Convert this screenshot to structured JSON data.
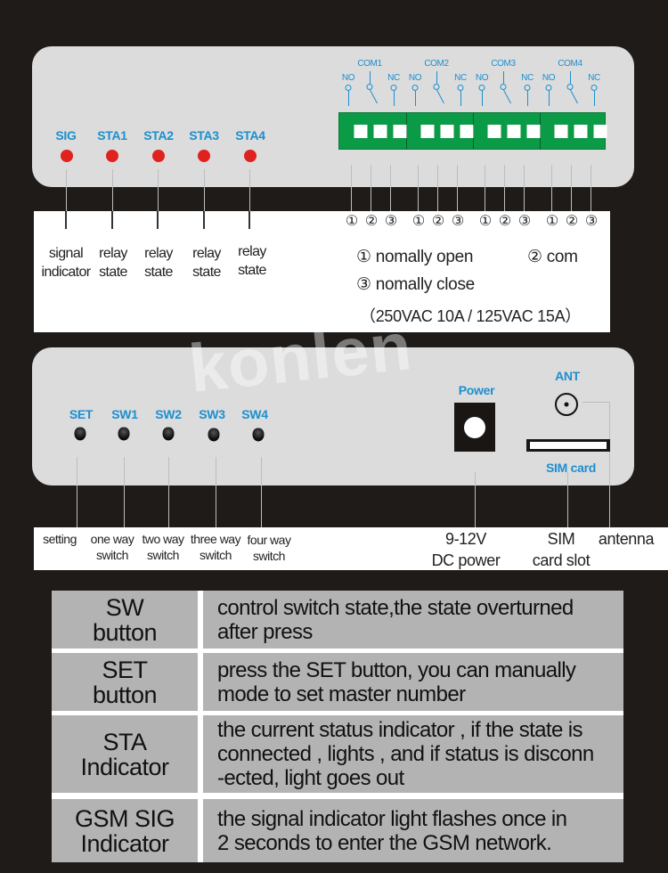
{
  "watermark": "konlen",
  "top_panel": {
    "indicators": [
      {
        "label": "SIG",
        "description_line1": "signal",
        "description_line2": "indicator",
        "led_color": "#e0221e"
      },
      {
        "label": "STA1",
        "description_line1": "relay",
        "description_line2": "state",
        "led_color": "#e0221e"
      },
      {
        "label": "STA2",
        "description_line1": "relay",
        "description_line2": "state",
        "led_color": "#e0221e"
      },
      {
        "label": "STA3",
        "description_line1": "relay",
        "description_line2": "state",
        "led_color": "#e0221e"
      },
      {
        "label": "STA4",
        "description_line1": "relay",
        "description_line2": "state",
        "led_color": "#e0221e"
      }
    ],
    "relays": [
      {
        "com": "COM1",
        "no": "NO",
        "nc": "NC",
        "pins": [
          "①",
          "②",
          "③"
        ]
      },
      {
        "com": "COM2",
        "no": "NO",
        "nc": "NC",
        "pins": [
          "①",
          "②",
          "③"
        ]
      },
      {
        "com": "COM3",
        "no": "NO",
        "nc": "NC",
        "pins": [
          "①",
          "②",
          "③"
        ]
      },
      {
        "com": "COM4",
        "no": "NO",
        "nc": "NC",
        "pins": [
          "①",
          "②",
          "③"
        ]
      }
    ],
    "legend": {
      "pin1": "① nomally open",
      "pin2": "② com",
      "pin3": "③ nomally close",
      "rating": "（250VAC 10A / 125VAC 15A）"
    }
  },
  "bottom_panel": {
    "buttons": [
      {
        "label": "SET",
        "description_line1": "setting",
        "description_line2": ""
      },
      {
        "label": "SW1",
        "description_line1": "one way",
        "description_line2": "switch"
      },
      {
        "label": "SW2",
        "description_line1": "two way",
        "description_line2": "switch"
      },
      {
        "label": "SW3",
        "description_line1": "three way",
        "description_line2": "switch"
      },
      {
        "label": "SW4",
        "description_line1": "four way",
        "description_line2": "switch"
      }
    ],
    "power": {
      "label": "Power",
      "description_line1": "9-12V",
      "description_line2": "DC power"
    },
    "sim": {
      "label": "SIM card",
      "description_line1": "SIM",
      "description_line2": "card slot"
    },
    "antenna": {
      "label": "ANT",
      "description_line1": "antenna"
    }
  },
  "colors": {
    "background": "#1e1b18",
    "panel": "#dcdcdc",
    "label_blue": "#1b8fd0",
    "led_red": "#e0221e",
    "terminal_green": "#0b9a46",
    "table_cell": "#b3b3b3"
  },
  "table": {
    "rows": [
      {
        "key_line1": "SW",
        "key_line2": "button",
        "value_lines": [
          "control switch state,the state overturned",
          "after press"
        ]
      },
      {
        "key_line1": "SET",
        "key_line2": "button",
        "value_lines": [
          "press the SET button, you can manually",
          "mode to set master number"
        ]
      },
      {
        "key_line1": "STA",
        "key_line2": "Indicator",
        "value_lines": [
          "the current status indicator ,  if  the state is",
          "connected , lights , and if status is disconn",
          "-ected, light goes out"
        ]
      },
      {
        "key_line1": "GSM SIG",
        "key_line2": "Indicator",
        "value_lines": [
          "the signal indicator light flashes once in",
          "2 seconds to enter the GSM network."
        ]
      }
    ]
  }
}
